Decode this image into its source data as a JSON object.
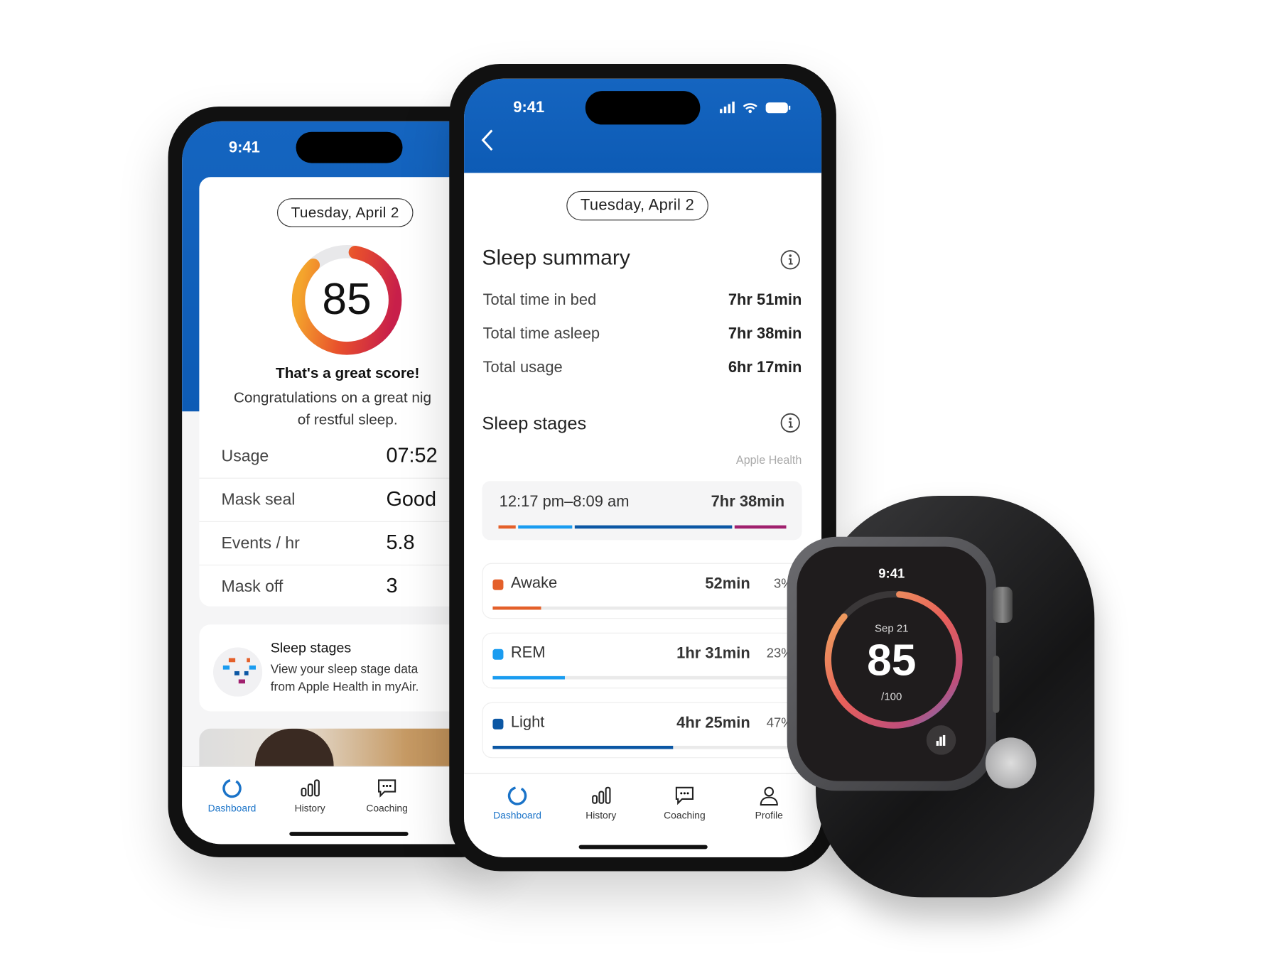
{
  "colors": {
    "brand_blue": "#1565c0",
    "awake": "#e4602a",
    "rem": "#1a9cf0",
    "light": "#0b57a4",
    "deep": "#a0206e"
  },
  "left_phone": {
    "status_time": "9:41",
    "date_pill": "Tuesday, April 2",
    "score": "85",
    "score_fraction": 0.85,
    "headline": "That's a great score!",
    "message_line1": "Congratulations on a great nig",
    "message_line2": "of restful sleep.",
    "metrics": [
      {
        "label": "Usage",
        "value": "07:52"
      },
      {
        "label": "Mask seal",
        "value": "Good"
      },
      {
        "label": "Events / hr",
        "value": "5.8"
      },
      {
        "label": "Mask off",
        "value": "3"
      }
    ],
    "sleep_card": {
      "title": "Sleep stages",
      "line1": "View your sleep stage data",
      "line2": "from Apple Health in myAir.",
      "icon": "sleep-stages-icon"
    },
    "tabs": [
      {
        "label": "Dashboard",
        "icon": "dashboard-ring-icon",
        "active": true
      },
      {
        "label": "History",
        "icon": "bar-chart-icon"
      },
      {
        "label": "Coaching",
        "icon": "chat-bubble-icon"
      }
    ]
  },
  "right_phone": {
    "status_time": "9:41",
    "back_icon": "chevron-left-icon",
    "date_pill": "Tuesday, April 2",
    "summary_title": "Sleep summary",
    "summary": [
      {
        "label": "Total time in bed",
        "value": "7hr 51min"
      },
      {
        "label": "Total time asleep",
        "value": "7hr 38min"
      },
      {
        "label": "Total usage",
        "value": "6hr 17min"
      }
    ],
    "stages_title": "Sleep stages",
    "source": "Apple Health",
    "timeline": {
      "range": "12:17 pm–8:09 am",
      "total": "7hr 38min"
    },
    "stages": [
      {
        "name": "Awake",
        "duration": "52min",
        "percent": "3%",
        "fill": 0.16,
        "color": "#e4602a"
      },
      {
        "name": "REM",
        "duration": "1hr 31min",
        "percent": "23%",
        "fill": 0.24,
        "color": "#1a9cf0"
      },
      {
        "name": "Light",
        "duration": "4hr 25min",
        "percent": "47%",
        "fill": 0.6,
        "color": "#0b57a4"
      }
    ],
    "tabs": [
      {
        "label": "Dashboard",
        "active": true
      },
      {
        "label": "History"
      },
      {
        "label": "Coaching"
      },
      {
        "label": "Profile"
      }
    ]
  },
  "watch": {
    "time": "9:41",
    "date": "Sep 21",
    "score": "85",
    "out_of": "/100",
    "score_fraction": 0.85
  }
}
